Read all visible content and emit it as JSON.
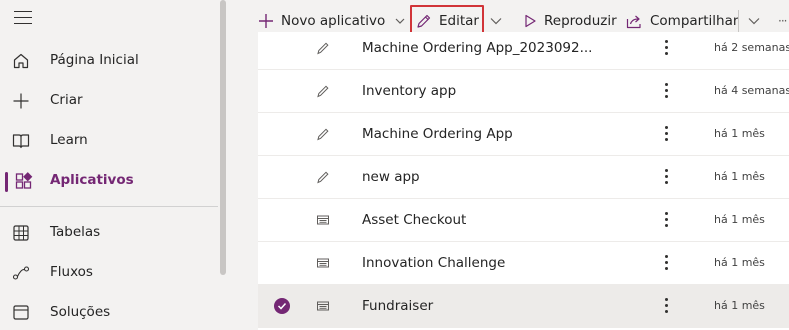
{
  "nav": {
    "items": [
      {
        "label": "Página Inicial",
        "icon": "home-icon"
      },
      {
        "label": "Criar",
        "icon": "plus-icon"
      },
      {
        "label": "Learn",
        "icon": "book-icon"
      },
      {
        "label": "Aplicativos",
        "icon": "apps-icon",
        "active": true
      },
      {
        "label": "Tabelas",
        "icon": "table-icon"
      },
      {
        "label": "Fluxos",
        "icon": "flow-icon"
      },
      {
        "label": "Soluções",
        "icon": "solutions-icon"
      }
    ]
  },
  "toolbar": {
    "new_app": "Novo aplicativo",
    "edit": "Editar",
    "play": "Reproduzir",
    "share": "Compartilhar",
    "overflow": "···"
  },
  "apps": [
    {
      "name": "Machine Ordering App_2023092...",
      "type": "canvas-icon",
      "modified": "há 2 semanas",
      "selected": false
    },
    {
      "name": "Inventory app",
      "type": "canvas-icon",
      "modified": "há 4 semanas",
      "selected": false
    },
    {
      "name": "Machine Ordering App",
      "type": "canvas-icon",
      "modified": "há 1 mês",
      "selected": false
    },
    {
      "name": "new app",
      "type": "canvas-icon",
      "modified": "há 1 mês",
      "selected": false
    },
    {
      "name": "Asset Checkout",
      "type": "model-driven-icon",
      "modified": "há 1 mês",
      "selected": false
    },
    {
      "name": "Innovation Challenge",
      "type": "model-driven-icon",
      "modified": "há 1 mês",
      "selected": false
    },
    {
      "name": "Fundraiser",
      "type": "model-driven-icon",
      "modified": "há 1 mês",
      "selected": true
    }
  ],
  "colors": {
    "accent": "#742774",
    "highlight_border": "#d13438"
  }
}
